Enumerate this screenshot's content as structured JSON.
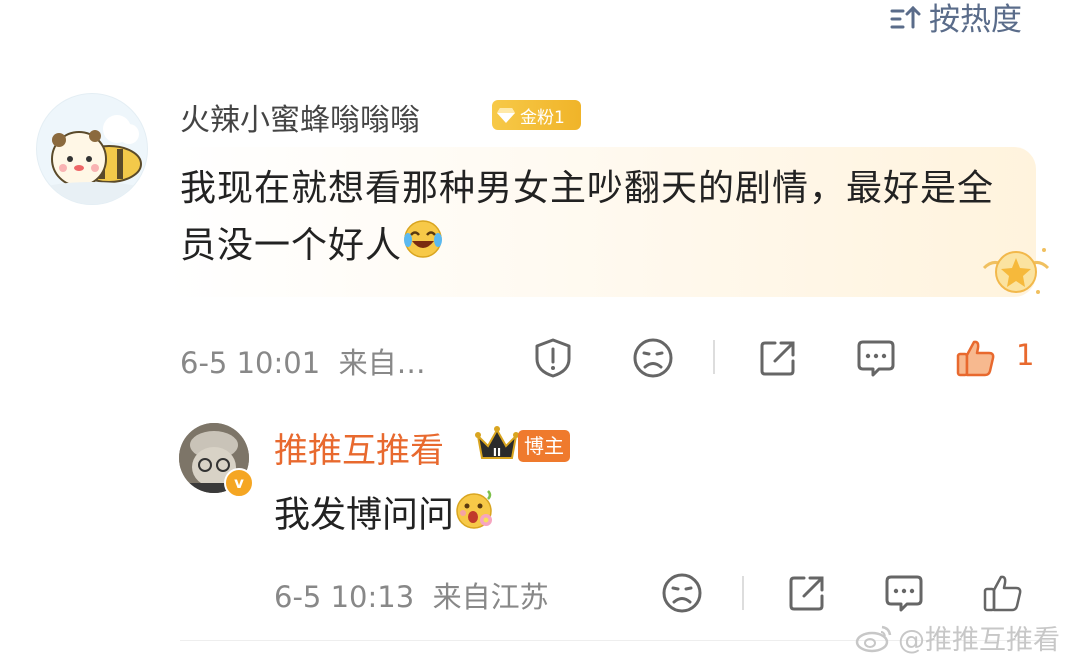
{
  "sort": {
    "label": "按热度",
    "icon": "sort-icon"
  },
  "comment": {
    "username": "火辣小蜜蜂嗡嗡嗡",
    "fan_badge": "金粉1",
    "text": "我现在就想看那种男女主吵翻天的剧情，最好是全员没一个好人",
    "emoji": "laugh-cry-emoji",
    "date": "6-5 10:01",
    "source": "来自…",
    "like_count": "1",
    "accent_color": "#e8692e",
    "icons": [
      "report-icon",
      "dislike-face-icon",
      "share-icon",
      "reply-icon",
      "like-thumb-icon"
    ]
  },
  "reply": {
    "username": "推推互推看",
    "crown_badge": "II",
    "host_badge": "博主",
    "verified": "v",
    "text": "我发博问问",
    "emoji": "flower-face-emoji",
    "date": "6-5 10:13",
    "source": "来自江苏",
    "icons": [
      "dislike-face-icon",
      "share-icon",
      "reply-icon",
      "like-thumb-icon"
    ]
  },
  "watermark": {
    "text": "@推推互推看",
    "icon": "weibo-logo-icon"
  }
}
